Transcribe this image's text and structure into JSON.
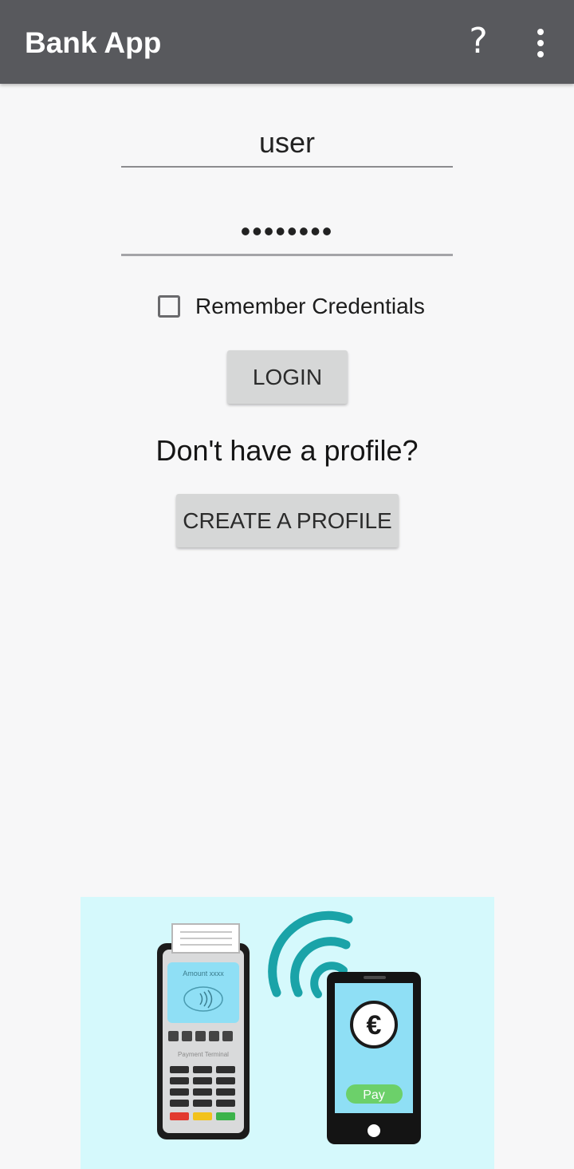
{
  "appbar": {
    "title": "Bank App",
    "help_icon": "?",
    "overflow_icon": "more-vertical-icon"
  },
  "login_form": {
    "username_value": "user",
    "password_value": "••••••••",
    "remember_label": "Remember Credentials",
    "remember_checked": false,
    "login_label": "LOGIN"
  },
  "signup": {
    "prompt": "Don't have a profile?",
    "create_label": "CREATE A PROFILE"
  },
  "illustration": {
    "terminal_amount_text": "Amount xxxx",
    "terminal_label_text": "Payment Terminal",
    "phone_currency_symbol": "€",
    "phone_pay_label": "Pay"
  },
  "colors": {
    "appbar": "#58595d",
    "background": "#f7f7f8",
    "button": "#d6d7d7",
    "illustration_bg": "#d5f9fc",
    "wifi_arcs": "#1aa3a8",
    "pay_button": "#6cd06a"
  }
}
